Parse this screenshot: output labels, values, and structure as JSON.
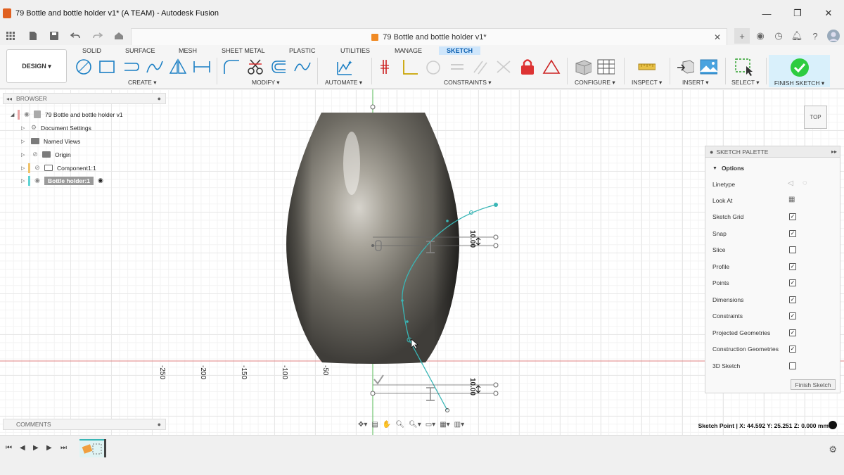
{
  "window": {
    "title": "79 Bottle and bottle holder v1* (A TEAM) - Autodesk Fusion",
    "minimize": "—",
    "maximize": "❐",
    "close": "✕"
  },
  "doc_tab": {
    "title": "79 Bottle and bottle holder v1*",
    "close": "✕"
  },
  "ribbon": {
    "workspace": "DESIGN ▾",
    "tabs": [
      "SOLID",
      "SURFACE",
      "MESH",
      "SHEET METAL",
      "PLASTIC",
      "UTILITIES",
      "MANAGE",
      "SKETCH"
    ],
    "active_tab": "SKETCH",
    "groups": [
      "CREATE ▾",
      "MODIFY ▾",
      "AUTOMATE ▾",
      "CONSTRAINTS ▾",
      "CONFIGURE ▾",
      "INSPECT ▾",
      "INSERT ▾",
      "SELECT ▾",
      "FINISH SKETCH ▾"
    ]
  },
  "browser": {
    "title": "BROWSER",
    "items": [
      {
        "label": "79 Bottle and bottle holder v1"
      },
      {
        "label": "Document Settings"
      },
      {
        "label": "Named Views"
      },
      {
        "label": "Origin"
      },
      {
        "label": "Component1:1"
      },
      {
        "label": "Bottle holder:1"
      }
    ]
  },
  "palette": {
    "title": "SKETCH PALETTE",
    "section": "Options",
    "rows": [
      {
        "label": "Linetype",
        "kind": "icons"
      },
      {
        "label": "Look At",
        "kind": "icon"
      },
      {
        "label": "Sketch Grid",
        "checked": true
      },
      {
        "label": "Snap",
        "checked": true
      },
      {
        "label": "Slice",
        "checked": false
      },
      {
        "label": "Profile",
        "checked": true
      },
      {
        "label": "Points",
        "checked": true
      },
      {
        "label": "Dimensions",
        "checked": true
      },
      {
        "label": "Constraints",
        "checked": true
      },
      {
        "label": "Projected Geometries",
        "checked": true
      },
      {
        "label": "Construction Geometries",
        "checked": true
      },
      {
        "label": "3D Sketch",
        "checked": false
      }
    ],
    "finish_button": "Finish Sketch"
  },
  "viewport": {
    "viewcube_label": "TOP",
    "ruler_ticks": [
      "-250",
      "-200",
      "-150",
      "-100",
      "-50"
    ],
    "dimension_top": "10.00",
    "dimension_bottom": "10.00"
  },
  "comments": {
    "title": "COMMENTS"
  },
  "status": {
    "text": "Sketch Point | X: 44.592 Y: 25.251 Z: 0.000 mm"
  },
  "colors": {
    "accent": "#0696d7",
    "finish_green": "#2ecc40",
    "axis_red": "#e08080",
    "axis_green": "#5cc05c",
    "sketch_curve": "#39b6b6"
  }
}
